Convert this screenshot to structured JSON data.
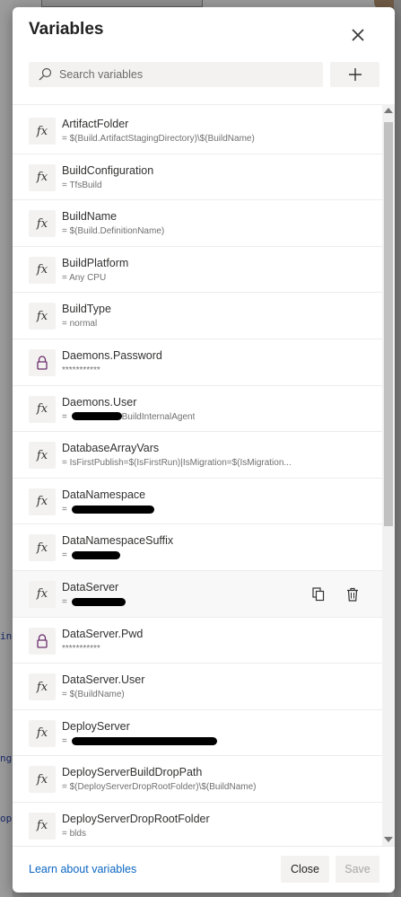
{
  "background": {
    "edge_texts": [
      "ing",
      "ng",
      "ope"
    ]
  },
  "dialog": {
    "title": "Variables",
    "search": {
      "placeholder": "Search variables",
      "value": ""
    },
    "footer": {
      "learn_link": "Learn about variables",
      "close_label": "Close",
      "save_label": "Save"
    }
  },
  "variables": [
    {
      "name": "ArtifactFolder",
      "value": "= $(Build.ArtifactStagingDirectory)\\$(BuildName)",
      "icon": "fx-icon"
    },
    {
      "name": "BuildConfiguration",
      "value": "= TfsBuild",
      "icon": "fx-icon"
    },
    {
      "name": "BuildName",
      "value": "= $(Build.DefinitionName)",
      "icon": "fx-icon"
    },
    {
      "name": "BuildPlatform",
      "value": "= Any CPU",
      "icon": "fx-icon"
    },
    {
      "name": "BuildType",
      "value": "= normal",
      "icon": "fx-icon"
    },
    {
      "name": "Daemons.Password",
      "value": "***********",
      "icon": "lock-icon"
    },
    {
      "name": "Daemons.User",
      "value": "= ",
      "value_suffix": "BuildInternalAgent",
      "icon": "fx-icon"
    },
    {
      "name": "DatabaseArrayVars",
      "value": "= IsFirstPublish=$(IsFirstRun)|IsMigration=$(IsMigration...",
      "icon": "fx-icon"
    },
    {
      "name": "DataNamespace",
      "value": "= ",
      "icon": "fx-icon"
    },
    {
      "name": "DataNamespaceSuffix",
      "value": "= ",
      "icon": "fx-icon"
    },
    {
      "name": "DataServer",
      "value": "= ",
      "icon": "fx-icon"
    },
    {
      "name": "DataServer.Pwd",
      "value": "***********",
      "icon": "lock-icon"
    },
    {
      "name": "DataServer.User",
      "value": "= $(BuildName)",
      "icon": "fx-icon"
    },
    {
      "name": "DeployServer",
      "value": "= ",
      "icon": "fx-icon"
    },
    {
      "name": "DeployServerBuildDropPath",
      "value": "= $(DeployServerDropRootFolder)\\$(BuildName)",
      "icon": "fx-icon"
    },
    {
      "name": "DeployServerDropRootFolder",
      "value": "= blds",
      "icon": "fx-icon"
    }
  ],
  "colors": {
    "link": "#0a66c2",
    "lock_icon": "#6b2d6b"
  }
}
